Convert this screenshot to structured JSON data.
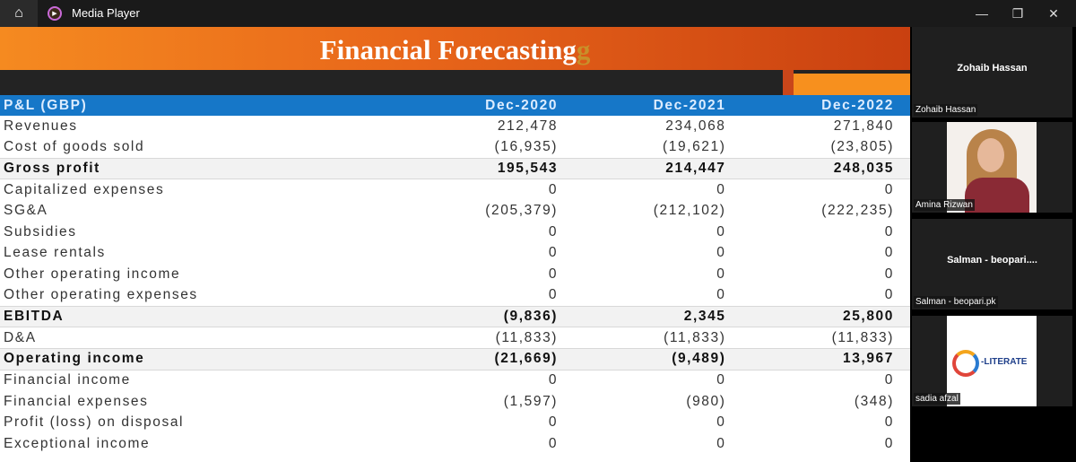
{
  "window": {
    "title": "Media Player",
    "icons": [
      "home-icon",
      "media-player-icon",
      "minimize-icon",
      "restore-icon",
      "close-icon"
    ]
  },
  "slide": {
    "title": "Financial Forecasting",
    "title_ghost": "g",
    "table": {
      "headers": [
        "P&L (GBP)",
        "Dec-2020",
        "Dec-2021",
        "Dec-2022"
      ],
      "rows": [
        {
          "label": "Revenues",
          "values": [
            "212,478",
            "234,068",
            "271,840"
          ],
          "bold": false
        },
        {
          "label": "Cost of goods sold",
          "values": [
            "(16,935)",
            "(19,621)",
            "(23,805)"
          ],
          "bold": false
        },
        {
          "label": "Gross profit",
          "values": [
            "195,543",
            "214,447",
            "248,035"
          ],
          "bold": true
        },
        {
          "label": "Capitalized expenses",
          "values": [
            "0",
            "0",
            "0"
          ],
          "bold": false
        },
        {
          "label": "SG&A",
          "values": [
            "(205,379)",
            "(212,102)",
            "(222,235)"
          ],
          "bold": false
        },
        {
          "label": "Subsidies",
          "values": [
            "0",
            "0",
            "0"
          ],
          "bold": false
        },
        {
          "label": "Lease rentals",
          "values": [
            "0",
            "0",
            "0"
          ],
          "bold": false
        },
        {
          "label": "Other operating income",
          "values": [
            "0",
            "0",
            "0"
          ],
          "bold": false
        },
        {
          "label": "Other operating expenses",
          "values": [
            "0",
            "0",
            "0"
          ],
          "bold": false
        },
        {
          "label": "EBITDA",
          "values": [
            "(9,836)",
            "2,345",
            "25,800"
          ],
          "bold": true
        },
        {
          "label": "D&A",
          "values": [
            "(11,833)",
            "(11,833)",
            "(11,833)"
          ],
          "bold": false
        },
        {
          "label": "Operating income",
          "values": [
            "(21,669)",
            "(9,489)",
            "13,967"
          ],
          "bold": true
        },
        {
          "label": "Financial income",
          "values": [
            "0",
            "0",
            "0"
          ],
          "bold": false
        },
        {
          "label": "Financial expenses",
          "values": [
            "(1,597)",
            "(980)",
            "(348)"
          ],
          "bold": false
        },
        {
          "label": "Profit (loss) on disposal",
          "values": [
            "0",
            "0",
            "0"
          ],
          "bold": false
        },
        {
          "label": "Exceptional income",
          "values": [
            "0",
            "0",
            "0"
          ],
          "bold": false
        }
      ]
    }
  },
  "participants": [
    {
      "center": "Zohaib Hassan",
      "label": "Zohaib Hassan"
    },
    {
      "center": "",
      "label": "Amina Rizwan"
    },
    {
      "center": "Salman - beopari....",
      "label": "Salman - beopari.pk"
    },
    {
      "center": "",
      "label": "sadia afzal",
      "logo_text": "-LITERATE"
    }
  ]
}
